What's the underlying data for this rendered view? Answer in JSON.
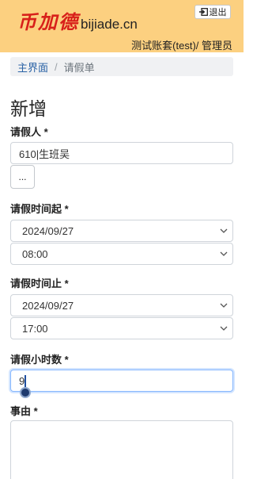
{
  "header": {
    "brand_cn": "币加德",
    "brand_en": "bijiade.cn",
    "logout_label": "退出",
    "account": "测试账套(test)/ 管理员"
  },
  "breadcrumb": {
    "home": "主界面",
    "separator": "/",
    "current": "请假单"
  },
  "page_title": "新增",
  "form": {
    "applicant": {
      "label": "请假人 *",
      "value": "610|生班吴",
      "picker_label": "..."
    },
    "start": {
      "label": "请假时间起 *",
      "date": "2024/09/27",
      "time": "08:00"
    },
    "end": {
      "label": "请假时间止 *",
      "date": "2024/09/27",
      "time": "17:00"
    },
    "hours": {
      "label": "请假小时数 *",
      "value": "9"
    },
    "reason": {
      "label": "事由 *",
      "value": ""
    }
  },
  "colors": {
    "header_bg": "#fcd080",
    "brand_red": "#d8201a",
    "link_blue": "#2b63a6",
    "focus": "#86b7fe"
  }
}
